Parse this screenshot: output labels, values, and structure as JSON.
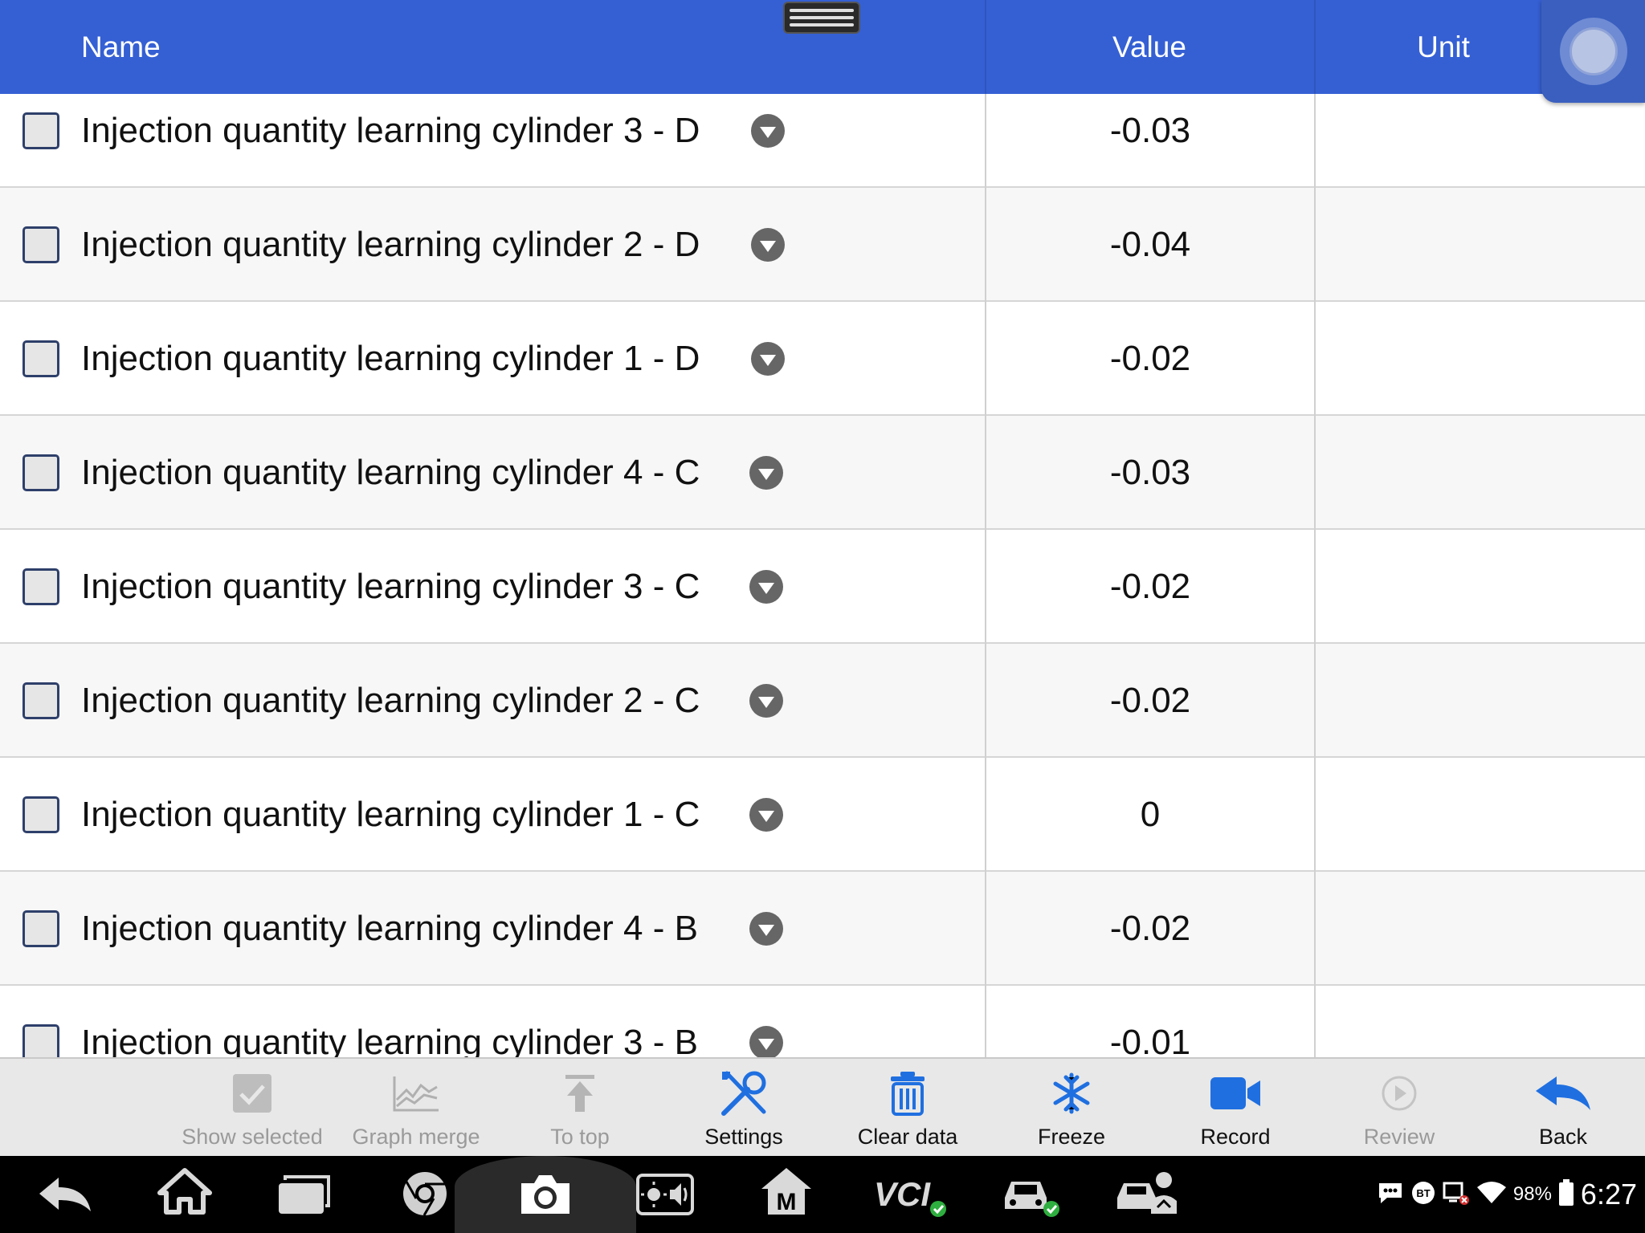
{
  "header": {
    "name_label": "Name",
    "value_label": "Value",
    "unit_label": "Unit"
  },
  "rows": [
    {
      "name": "Injection quantity learning cylinder 3 - D",
      "value": "-0.03",
      "unit": ""
    },
    {
      "name": "Injection quantity learning cylinder 2 - D",
      "value": "-0.04",
      "unit": ""
    },
    {
      "name": "Injection quantity learning cylinder 1 - D",
      "value": "-0.02",
      "unit": ""
    },
    {
      "name": "Injection quantity learning cylinder 4 - C",
      "value": "-0.03",
      "unit": ""
    },
    {
      "name": "Injection quantity learning cylinder 3 - C",
      "value": "-0.02",
      "unit": ""
    },
    {
      "name": "Injection quantity learning cylinder 2 - C",
      "value": "-0.02",
      "unit": ""
    },
    {
      "name": "Injection quantity learning cylinder 1 - C",
      "value": "0",
      "unit": ""
    },
    {
      "name": "Injection quantity learning cylinder 4 - B",
      "value": "-0.02",
      "unit": ""
    },
    {
      "name": "Injection quantity learning cylinder 3 - B",
      "value": "-0.01",
      "unit": ""
    }
  ],
  "toolbar": {
    "show_selected": "Show selected",
    "graph_merge": "Graph merge",
    "to_top": "To top",
    "settings": "Settings",
    "clear_data": "Clear data",
    "freeze": "Freeze",
    "record": "Record",
    "review": "Review",
    "back": "Back"
  },
  "navbar": {
    "icons": [
      "back-icon",
      "home-icon",
      "recent-apps-icon",
      "chrome-icon",
      "camera-icon",
      "brightness-volume-icon",
      "maxifix-icon",
      "vci-icon",
      "car-connected-icon",
      "car-service-icon"
    ],
    "vci_label": "VCI",
    "maxifix_label": "M"
  },
  "status_bar": {
    "bt_label": "BT",
    "battery_pct": "98%",
    "time": "6:27"
  },
  "colors": {
    "header_bg": "#3560d4",
    "accent_blue": "#1f6fe0",
    "toolbar_bg": "#e8e8e8"
  }
}
